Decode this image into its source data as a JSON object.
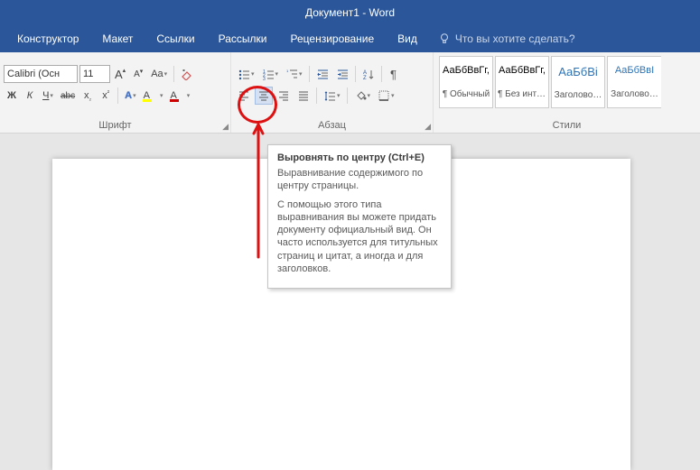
{
  "title": "Документ1  -  Word",
  "tabs": [
    "Конструктор",
    "Макет",
    "Ссылки",
    "Рассылки",
    "Рецензирование",
    "Вид"
  ],
  "tellme": "Что вы хотите сделать?",
  "font": {
    "name": "Calibri (Осн",
    "size": "11"
  },
  "groups": {
    "font": "Шрифт",
    "para": "Абзац",
    "styles": "Стили"
  },
  "buttons": {
    "grow": "A",
    "shrink": "A",
    "case": "Aa",
    "bold": "Ж",
    "italic": "К",
    "underline": "Ч",
    "strike": "abc",
    "sub": "x",
    "sup": "x",
    "fx": "A",
    "highlight": "A",
    "fontcolor": "A"
  },
  "styles": [
    {
      "preview": "АаБбВвГг,",
      "name": "¶ Обычный",
      "cls": ""
    },
    {
      "preview": "АаБбВвГг,",
      "name": "¶ Без инте…",
      "cls": ""
    },
    {
      "preview": "АаБбВі",
      "name": "Заголово…",
      "cls": "hd1"
    },
    {
      "preview": "АаБбВвI",
      "name": "Заголово…",
      "cls": "hd2"
    }
  ],
  "tooltip": {
    "title": "Выровнять по центру (Ctrl+E)",
    "p1": "Выравнивание содержимого по центру страницы.",
    "p2": "С помощью этого типа выравнивания вы можете придать документу официальный вид. Он часто используется для титульных страниц и цитат, а иногда и для заголовков."
  }
}
